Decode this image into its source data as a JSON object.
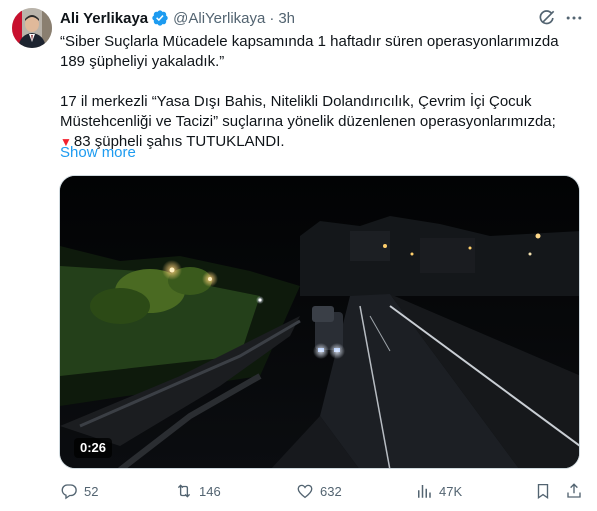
{
  "author": {
    "name": "Ali Yerlikaya",
    "handle": "@AliYerlikaya",
    "separator": "·",
    "time": "3h",
    "verified": true
  },
  "tweet": {
    "paragraph1": "“Siber Suçlarla Mücadele kapsamında 1 haftadır süren operasyonlarımızda 189 şüpheliyi yakaladık.”",
    "paragraph2_line1": "17 il merkezli “Yasa Dışı Bahis, Nitelikli Dolandırıcılık, Çevrim İçi Çocuk",
    "paragraph2_line2": "Müstehcenliği ve Tacizi” suçlarına yönelik düzenlenen operasyonlarımızda;",
    "paragraph2_line3": "83 şüpheli şahıs TUTUKLANDI.",
    "show_more": "Show more"
  },
  "media": {
    "type": "video",
    "duration": "0:26",
    "description_icon": "video-thumbnail"
  },
  "actions": {
    "replies": "52",
    "reposts": "146",
    "likes": "632",
    "views": "47K"
  },
  "colors": {
    "text": "#0f1419",
    "secondary": "#536471",
    "link": "#1d9bf0",
    "verified": "#1d9bf0",
    "heart_emoji": "#f4212e"
  },
  "icons": {
    "verified": "verified-badge-icon",
    "grok": "grok-icon",
    "more": "more-icon",
    "reply": "reply-icon",
    "repost": "repost-icon",
    "like": "heart-icon",
    "views": "views-icon",
    "bookmark": "bookmark-icon",
    "share": "share-icon"
  }
}
